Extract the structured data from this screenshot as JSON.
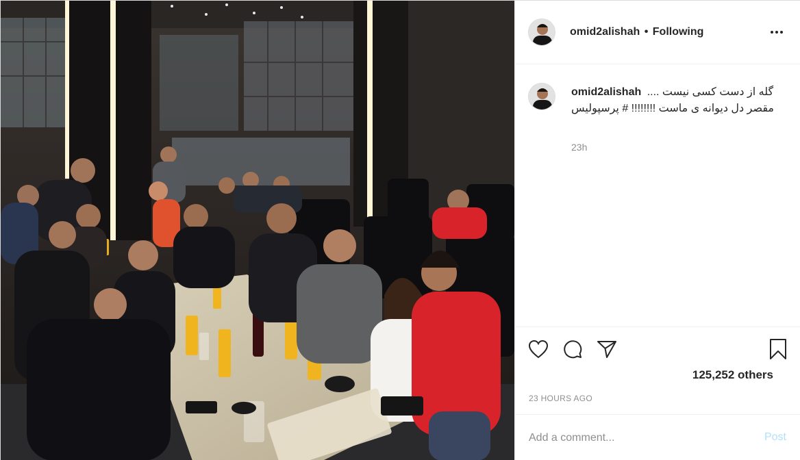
{
  "post": {
    "username": "omid2alishah",
    "follow_status": "Following",
    "separator": "•",
    "more_icon": "more-horizontal-icon",
    "caption": {
      "username": "omid2alishah",
      "text": "گله از دست کسی نیست .... مقصر دل دیوانه ی ماست !!!!!!!! # پرسپولیس"
    },
    "caption_time": "23h",
    "actions": {
      "like_icon": "heart-icon",
      "comment_icon": "comment-icon",
      "share_icon": "share-icon",
      "save_icon": "bookmark-icon"
    },
    "likes_text": "125,252 others",
    "posted_ago": "23 HOURS AGO",
    "add_comment_placeholder": "Add a comment...",
    "post_button": "Post"
  },
  "colors": {
    "text": "#262626",
    "muted": "#8e8e8e",
    "border": "#efefef",
    "post_disabled": "#b2dffc"
  }
}
